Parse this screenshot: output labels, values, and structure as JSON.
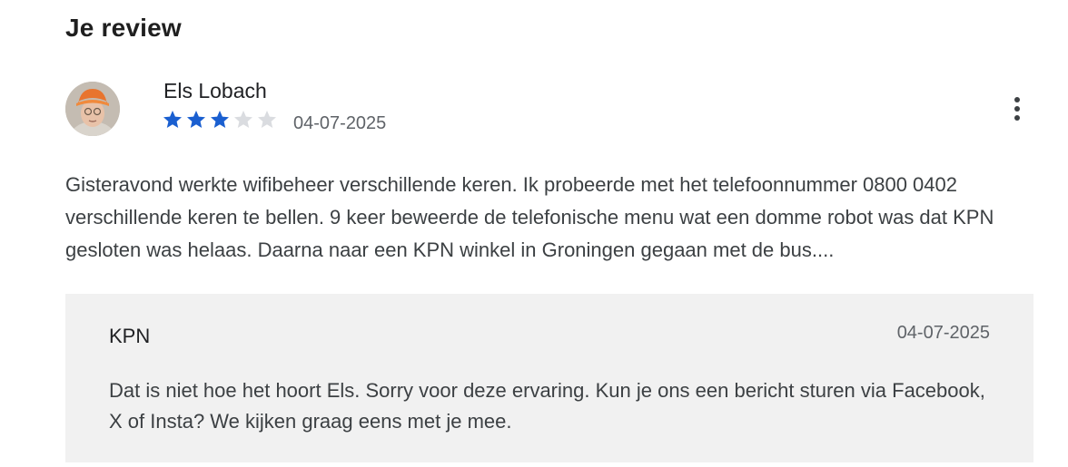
{
  "section": {
    "title": "Je review"
  },
  "review": {
    "author": "Els Lobach",
    "rating": 3,
    "max_rating": 5,
    "date": "04-07-2025",
    "text": "Gisteravond werkte wifibeheer verschillende keren. Ik probeerde met het telefoonnummer 0800 0402 verschillende keren te bellen. 9 keer beweerde de telefonische menu wat een domme robot was dat KPN gesloten was helaas. Daarna naar een KPN winkel in Groningen gegaan met de bus....",
    "more_icon": "more-vert-icon",
    "avatar_icon": "profile-photo"
  },
  "reply": {
    "author": "KPN",
    "date": "04-07-2025",
    "text": "Dat is niet hoe het hoort Els. Sorry voor deze ervaring. Kun je ons een bericht sturen via Facebook, X of Insta? We kijken graag eens met je mee."
  },
  "colors": {
    "star_filled": "#1a5fd0",
    "star_empty": "#dadce0",
    "reply_background": "#f1f1f1"
  }
}
